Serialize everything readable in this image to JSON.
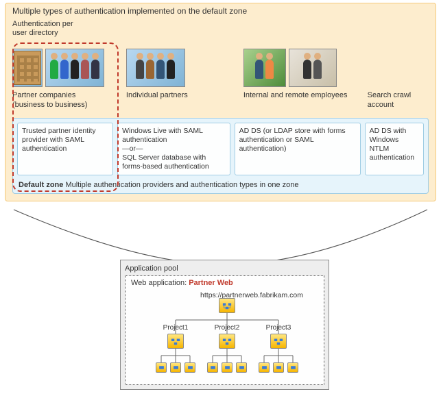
{
  "title": "Multiple types of authentication implemented on the default zone",
  "auth_per_dir_label": "Authentication per\nuser directory",
  "categories": {
    "partner_companies": {
      "label": "Partner companies\n(business to business)",
      "auth": "Trusted partner identity provider with SAML authentication"
    },
    "individual_partners": {
      "label": "Individual partners",
      "auth": "Windows Live with SAML authentication\n—or—\nSQL Server database with forms-based authentication"
    },
    "internal_employees": {
      "label": "Internal and remote employees",
      "auth": "AD DS  (or LDAP store with forms authentication or SAML authentication)"
    },
    "search_crawl": {
      "label": "Search crawl account",
      "auth": "AD DS with Windows NTLM authentication"
    }
  },
  "default_zone": {
    "bold": "Default zone",
    "rest": "  Multiple authentication providers and authentication types in one zone"
  },
  "app_pool": {
    "title": "Application pool",
    "web_app_label": "Web application:",
    "web_app_name": "Partner Web",
    "url": "https://partnerweb.fabrikam.com",
    "projects": [
      "Project1",
      "Project2",
      "Project3"
    ]
  }
}
